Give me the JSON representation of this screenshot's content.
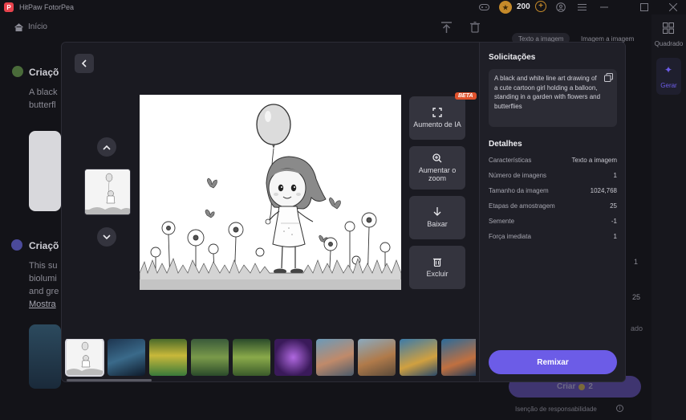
{
  "app": {
    "title": "HitPaw FotorPea",
    "credits": "200"
  },
  "background": {
    "home_label": "Início",
    "section1_title": "Criaçõ",
    "section1_text_1": "A black",
    "section1_text_2": "butterfl",
    "section2_title": "Criaçõ",
    "section2_text_1": "This su",
    "section2_text_2": "biolumi",
    "section2_text_3": "and gre",
    "section2_link": "Mostra",
    "tab_text_to_image": "Texto a imagem",
    "tab_image_to_image": "Imagem a imagem",
    "value_1": "1",
    "value_25": "25",
    "partial_text": "ado",
    "create_label": "Criar",
    "create_cost": "2",
    "disclaimer": "Isenção de responsabilidade"
  },
  "rail": {
    "item1": "Quadrado",
    "item2": "Gerar"
  },
  "modal": {
    "actions": {
      "upscale": "Aumento de IA",
      "zoom": "Aumentar o zoom",
      "download": "Baixar",
      "delete": "Excluir",
      "beta_badge": "BETA"
    },
    "sidebar": {
      "prompt_heading": "Solicitações",
      "prompt_text": "A black and white line art drawing of a cute cartoon girl holding a balloon, standing in a garden with flowers and butterflies",
      "details_heading": "Detalhes",
      "details": [
        {
          "label": "Características",
          "value": "Texto a imagem"
        },
        {
          "label": "Número de imagens",
          "value": "1"
        },
        {
          "label": "Tamanho da imagem",
          "value": "1024,768"
        },
        {
          "label": "Etapas de amostragem",
          "value": "25"
        },
        {
          "label": "Semente",
          "value": "-1"
        },
        {
          "label": "Força imediata",
          "value": "1"
        }
      ],
      "remix_label": "Remixar"
    }
  },
  "colors": {
    "accent": "#6c5ce7",
    "beta": "#e0522c",
    "coin": "#c58a2a"
  },
  "icons": [
    "back-icon",
    "chevron-up-icon",
    "chevron-down-icon",
    "expand-icon",
    "zoom-in-icon",
    "download-icon",
    "trash-icon",
    "copy-icon",
    "home-icon",
    "share-icon",
    "gamepad-icon"
  ]
}
